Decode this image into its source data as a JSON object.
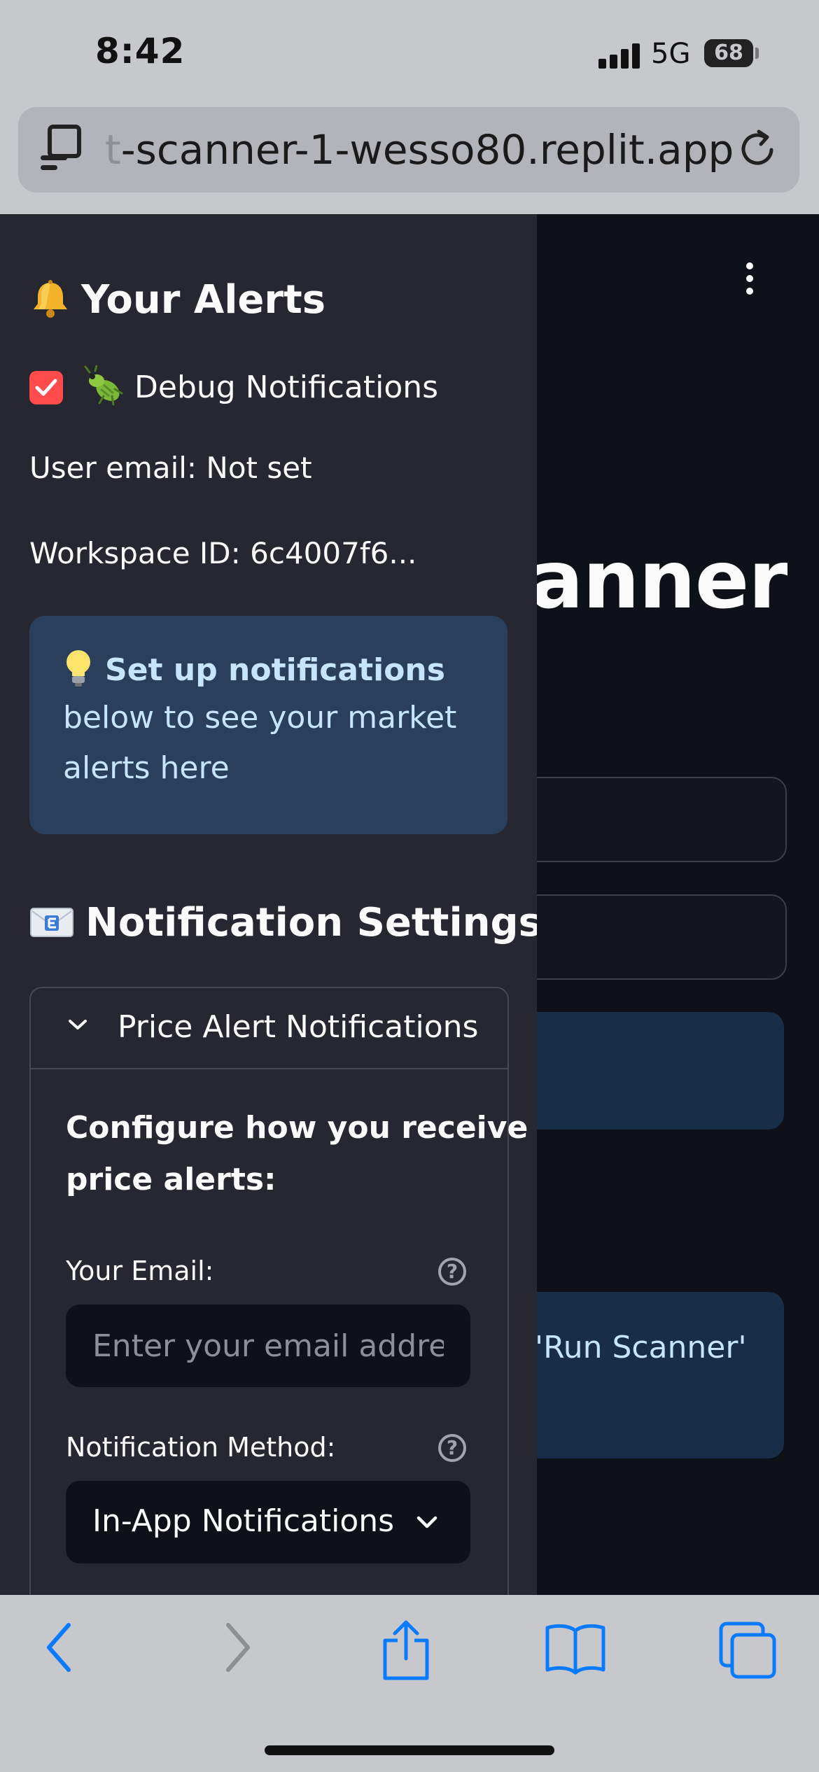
{
  "status_bar": {
    "time": "8:42",
    "network": "5G",
    "battery": "68"
  },
  "browser": {
    "url_faded": "t",
    "url": "-scanner-1-wesso80.replit.app"
  },
  "main": {
    "title_fragment": "canner",
    "info_fragment": "'Run Scanner'"
  },
  "sidebar": {
    "alerts_heading": "Your Alerts",
    "debug_label": "Debug Notifications",
    "debug_checked": true,
    "user_email": "User email: Not set",
    "workspace_id": "Workspace ID: 6c4007f6...",
    "info": {
      "bold": "Set up notifications",
      "line2": "below to see your market",
      "line3": "alerts here"
    },
    "settings_heading": "Notification Settings",
    "expander": {
      "title": "Price Alert Notifications",
      "intro_line1": "Configure how you receive",
      "intro_line2": "price alerts:",
      "email_label": "Your Email:",
      "email_placeholder": "Enter your email address",
      "method_label": "Notification Method:",
      "method_value": "In-App Notifications"
    }
  },
  "colors": {
    "accent": "#ff4b4b",
    "sidebar_bg": "#262730",
    "info_bg": "#2a3f5c",
    "ios_blue": "#0a7aff"
  }
}
